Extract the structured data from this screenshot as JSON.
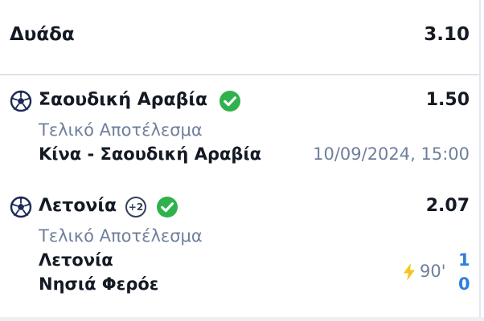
{
  "header": {
    "title": "Δυάδα",
    "total_odds": "3.10"
  },
  "selections": [
    {
      "name": "Σαουδική Αραβία",
      "status_icon": "check-circle-icon",
      "odds": "1.50",
      "market": "Τελικό Αποτέλεσμα",
      "event": "Κίνα - Σαουδική Αραβία",
      "datetime": "10/09/2024, 15:00"
    },
    {
      "name": "Λετονία",
      "badge": "+2",
      "status_icon": "check-circle-icon",
      "odds": "2.07",
      "market": "Τελικό Αποτέλεσμα",
      "home_team": "Λετονία",
      "away_team": "Νησιά Φερόε",
      "minute": "90'",
      "home_score": "1",
      "away_score": "0"
    }
  ],
  "colors": {
    "text": "#141a24",
    "muted": "#6f7f9c",
    "check_green": "#2fb24c",
    "score_blue": "#2f7fe0",
    "bolt_yellow": "#f5c518"
  }
}
